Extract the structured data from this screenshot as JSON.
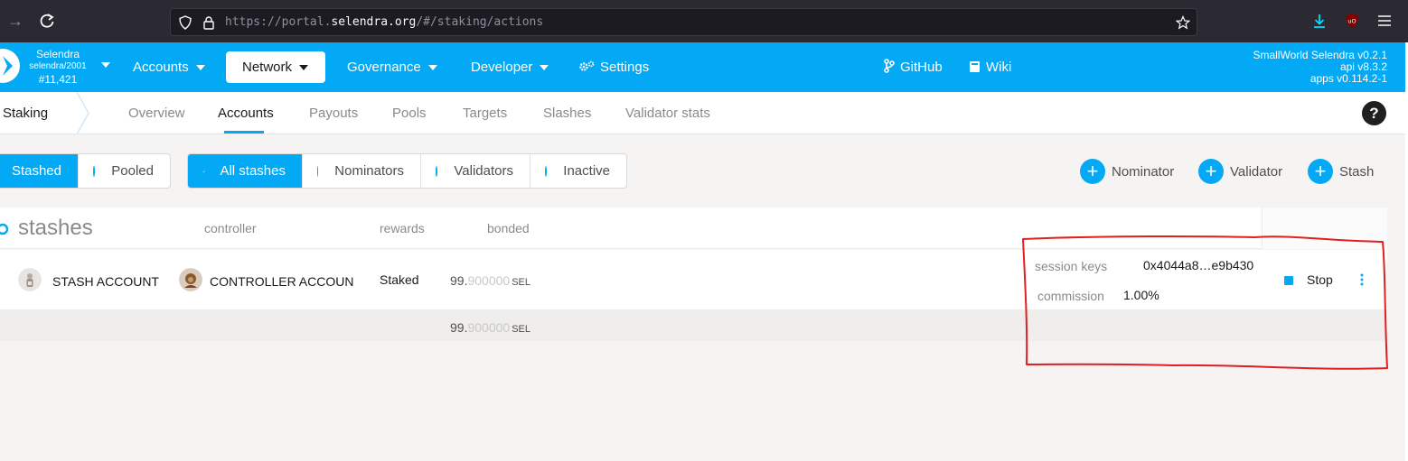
{
  "browser": {
    "url_prefix": "https://portal.",
    "url_domain": "selendra.org",
    "url_path": "/#/staking/actions"
  },
  "header": {
    "chain_name": "Selendra",
    "chain_spec": "selendra/2001",
    "block": "#11,421",
    "menu": [
      {
        "label": "Accounts"
      },
      {
        "label": "Network"
      },
      {
        "label": "Governance"
      },
      {
        "label": "Developer"
      },
      {
        "label": "Settings"
      }
    ],
    "links": [
      {
        "label": "GitHub"
      },
      {
        "label": "Wiki"
      }
    ],
    "versions": [
      "SmallWorld Selendra v0.2.1",
      "api v8.3.2",
      "apps v0.114.2-1"
    ]
  },
  "subnav": {
    "section": "Staking",
    "tabs": [
      "Overview",
      "Accounts",
      "Payouts",
      "Pools",
      "Targets",
      "Slashes",
      "Validator stats"
    ]
  },
  "filters": {
    "type": [
      "Stashed",
      "Pooled"
    ],
    "role": [
      "All stashes",
      "Nominators",
      "Validators",
      "Inactive"
    ]
  },
  "actions": [
    "Nominator",
    "Validator",
    "Stash"
  ],
  "table": {
    "title": "stashes",
    "headers": {
      "controller": "controller",
      "rewards": "rewards",
      "bonded": "bonded"
    },
    "row": {
      "stash": "STASH ACCOUNT",
      "controller": "CONTROLLER ACCOUN",
      "rewards": "Staked",
      "bonded_int": "99.",
      "bonded_dec": "900000",
      "unit": "SEL",
      "session_keys_label": "session keys",
      "session_keys": "0x4044a8…e9b430",
      "commission_label": "commission",
      "commission": "1.00%",
      "stop": "Stop"
    },
    "total": {
      "int": "99.",
      "dec": "900000",
      "unit": "SEL"
    }
  },
  "colors": {
    "accent": "#03a9f4",
    "annotation": "#e02020"
  }
}
